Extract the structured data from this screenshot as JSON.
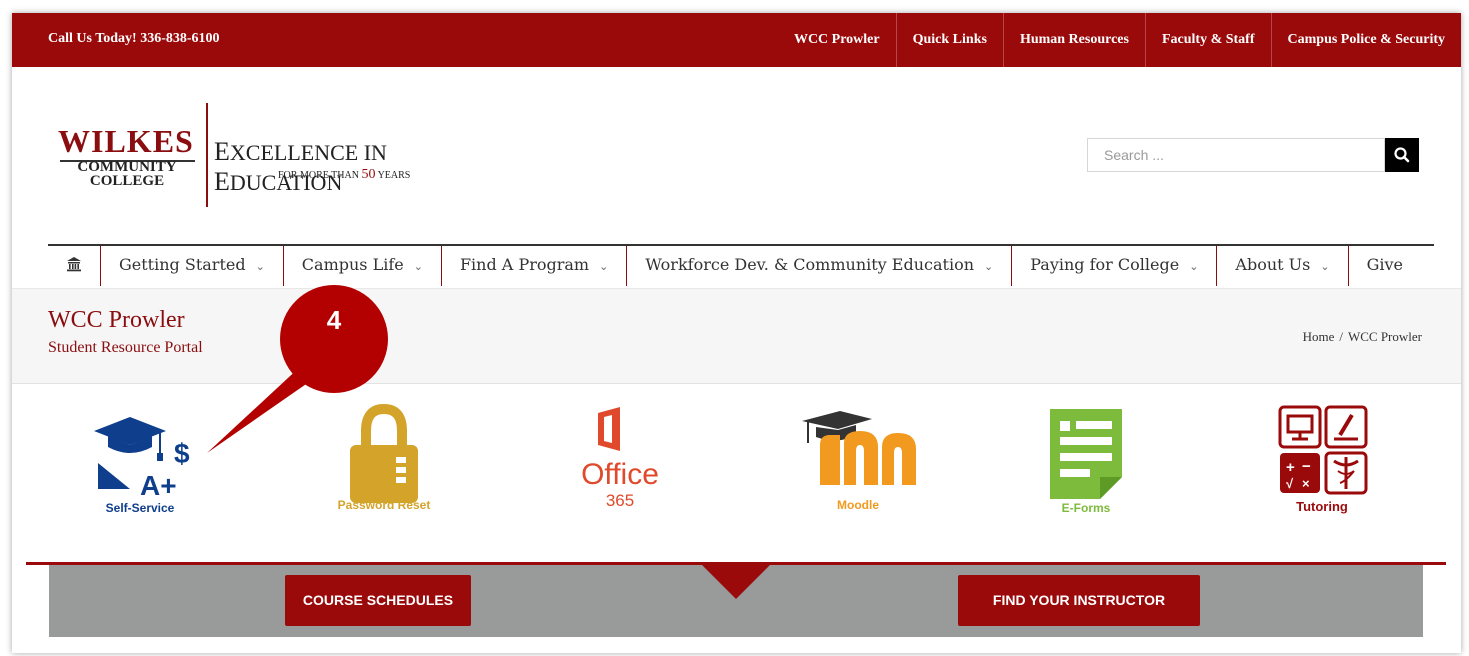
{
  "topbar": {
    "phone": "Call Us Today! 336-838-6100",
    "links": [
      "WCC Prowler",
      "Quick Links",
      "Human Resources",
      "Faculty & Staff",
      "Campus Police & Security"
    ]
  },
  "logo": {
    "wilkes": "WILKES",
    "community": "COMMUNITY",
    "college": "COLLEGE",
    "tagline_e1": "E",
    "tagline_rest1": "XCELLENCE IN ",
    "tagline_e2": "E",
    "tagline_rest2": "DUCATION",
    "sub_pre": "FOR MORE THAN ",
    "sub_num": "50",
    "sub_post": " YEARS"
  },
  "search": {
    "placeholder": "Search ..."
  },
  "nav": {
    "items": [
      "Getting Started",
      "Campus Life",
      "Find A Program",
      "Workforce Dev. & Community Education",
      "Paying for College",
      "About Us",
      "Give"
    ]
  },
  "title": {
    "heading": "WCC Prowler",
    "subheading": "Student Resource Portal",
    "crumb_home": "Home",
    "crumb_sep": "/",
    "crumb_current": "WCC Prowler"
  },
  "callout": {
    "number": "4"
  },
  "tiles": {
    "self_service": "Self-Service",
    "password": "Password Reset",
    "office": "Office",
    "office_num": "365",
    "moodle": "Moodle",
    "eforms": "E-Forms",
    "tutoring": "Tutoring"
  },
  "buttons": {
    "course": "COURSE SCHEDULES",
    "instructor": "FIND YOUR INSTRUCTOR"
  },
  "colors": {
    "brand": "#9b0a0b",
    "gold": "#d3a32a",
    "office": "#e0492b",
    "moodle": "#f29a1f",
    "eforms": "#7dbb3c",
    "navy": "#0f3e8c"
  }
}
